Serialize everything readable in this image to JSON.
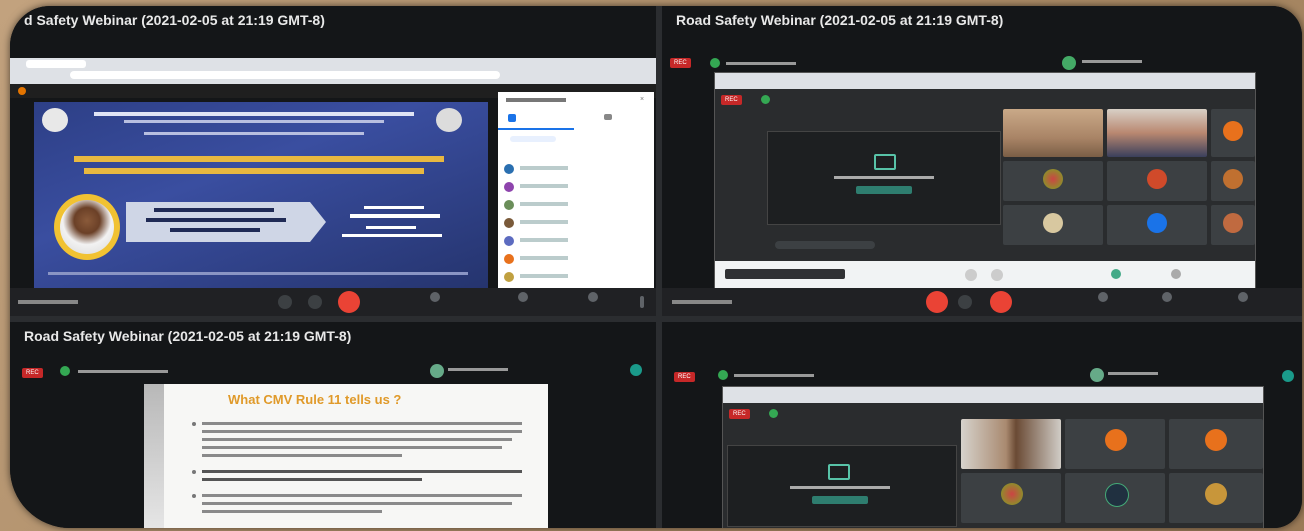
{
  "webinar": {
    "title": "Road Safety Webinar (2021-02-05 at 21:19 GMT-8)",
    "title_clipped": "d Safety Webinar (2021-02-05 at 21:19 GMT-8)"
  },
  "quadrants": {
    "q3": {
      "slide_title": "What CMV Rule 11 tells us ?"
    }
  },
  "colors": {
    "end_call": "#ea4335",
    "recording": "#c62828",
    "presenting_dot": "#34a853",
    "slide_heading": "#e09a2a",
    "accent_teal": "#58c3a8"
  },
  "icons": [
    "mic-icon",
    "camera-icon",
    "end-call-icon",
    "present-icon",
    "people-icon",
    "chat-icon",
    "captions-icon",
    "more-icon"
  ]
}
